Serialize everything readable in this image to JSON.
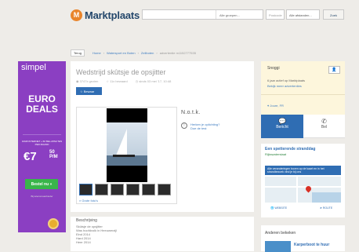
{
  "header": {
    "logo_mark": "M",
    "logo_text": "Marktplaats",
    "category_select": "Alle groepen...",
    "postcode_placeholder": "Postcode",
    "distance_select": "Alle afstanden...",
    "search_button": "Zoek"
  },
  "breadcrumb": {
    "back": "Terug",
    "items": [
      "Home",
      "Watersport en Boten",
      "Zeilboten",
      "advertentie m1152777535"
    ]
  },
  "ad_left": {
    "brand": "simpel",
    "headline_1": "EURO",
    "headline_2": "DEALS",
    "fine_print": "10GB INTERNET + 60 BEL-MINUTEN PER MAAND",
    "price": "€7",
    "price_cents": "50",
    "price_unit": "P/M",
    "cta": "Bestel nu »",
    "note": "Bij telecomaanbieder"
  },
  "listing": {
    "title": "Wedstrijd skûtsje de opsjitter",
    "views": "3747x gezien",
    "saved": "11x bewaard",
    "since": "sinds 03 mei '17, 10:48",
    "save_button": "Bewaar",
    "seller_name": "N.o.t.k.",
    "tip_line1": "Herken je oplichting?",
    "tip_line2": "Doe de test",
    "larger_photo": "Grote foto's"
  },
  "description": {
    "heading": "Beschrijving",
    "lines": [
      "Skûtsje de opsjitter",
      "Was hoofdvolk in Heeuwerzijl",
      "Eind 2014",
      "Hard 2014",
      "Heer 2014"
    ]
  },
  "contact": {
    "name": "Snoggi",
    "active": "6 jaar actief op Marktplaats",
    "other_ads": "Bekijk meer advertenties",
    "location": "Joure, FR",
    "message_button": "Bericht",
    "call_button": "Bel"
  },
  "map_ad": {
    "title": "Een spetterende stranddag",
    "subtitle": "Rijkswaterstaat",
    "banner": "Alle veranderingen boven op de kaart en in het strandbezoek vind je bij ons",
    "btn_website": "WEBSITE",
    "btn_route": "ROUTE"
  },
  "also_seen": {
    "heading": "Anderen bekeken",
    "item_title": "Karperboot te huur"
  },
  "colors": {
    "brand_blue": "#2f6db3",
    "logo_orange": "#e9852c",
    "ad_purple": "#8b3fc2"
  }
}
